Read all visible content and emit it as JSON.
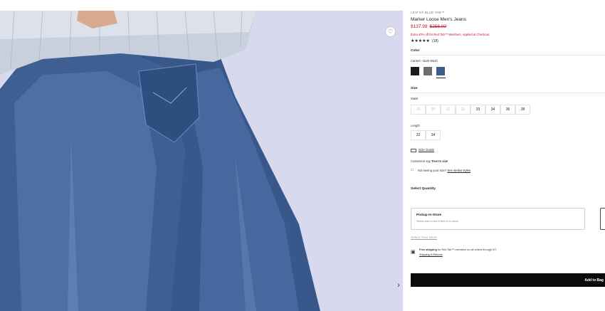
{
  "product": {
    "brand": "LEVI'S® BLUE TAB™",
    "title": "Marker Loose Men's Jeans",
    "price_sale": "$137.98",
    "price_original": "$258.00",
    "promo": "Extra 40% off for Red Tab™ Members. Applied at Checkout.",
    "rating_stars": "★★★★★",
    "rating_count": "(18)"
  },
  "color": {
    "label": "Color",
    "selected_name": "Carmel - Dark Wash",
    "swatches": [
      {
        "name": "black",
        "hex": "#1b1b1b"
      },
      {
        "name": "grey",
        "hex": "#6d6d6d"
      },
      {
        "name": "dark-wash",
        "hex": "#3c5a8c",
        "selected": true
      }
    ]
  },
  "size": {
    "label": "Size",
    "waist_label": "Waist",
    "waist_options": [
      {
        "value": "29",
        "available": false
      },
      {
        "value": "30",
        "available": false
      },
      {
        "value": "31",
        "available": false
      },
      {
        "value": "32",
        "available": false
      },
      {
        "value": "33",
        "available": true
      },
      {
        "value": "34",
        "available": true
      },
      {
        "value": "36",
        "available": true
      },
      {
        "value": "38",
        "available": true
      }
    ],
    "length_label": "Length",
    "length_options": [
      {
        "value": "32",
        "available": true
      },
      {
        "value": "34",
        "available": true
      }
    ],
    "size_guide_label": "Size Guide",
    "fit_note_prefix": "Customers say ",
    "fit_note_value": "True to size",
    "not_seeing_text": "Not seeing your size?",
    "similar_styles_link": "See similar styles"
  },
  "quantity": {
    "label": "Select Quantity"
  },
  "pickup": {
    "title": "Pickup In-Store",
    "subtitle": "Select size to see if item is in stock",
    "select_store_link": "Select Your Store"
  },
  "shipping": {
    "bold": "Free shipping",
    "text": " for Red Tab™ members on all orders through 9/7.",
    "returns_link": "Shipping & Returns"
  },
  "cta": {
    "add_to_bag": "Add to Bag"
  },
  "icons": {
    "wishlist": "heart-icon",
    "next": "chevron-right-icon",
    "ruler": "ruler-icon",
    "hanger": "hanger-icon",
    "shipping": "box-icon"
  }
}
